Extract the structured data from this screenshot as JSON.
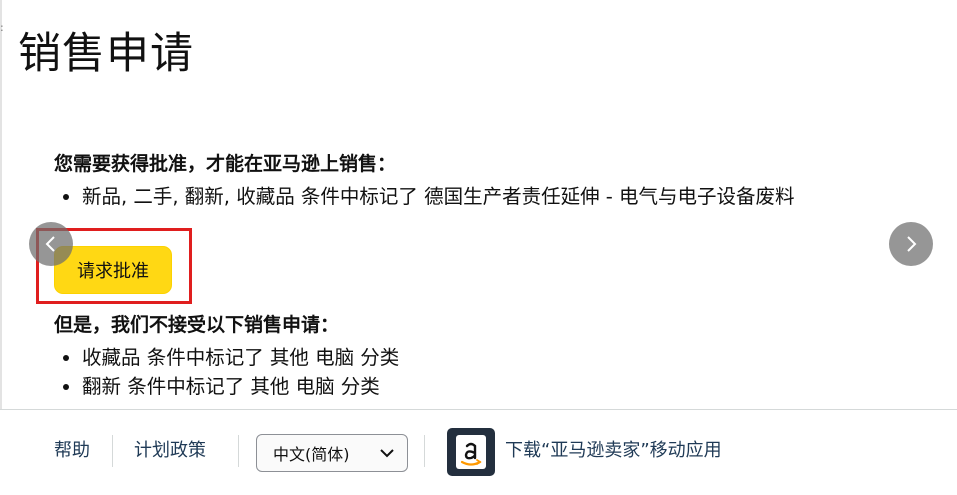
{
  "page": {
    "title": "销售申请"
  },
  "approval": {
    "heading": "您需要获得批准，才能在亚马逊上销售：",
    "items": [
      "新品, 二手, 翻新, 收藏品 条件中标记了 德国生产者责任延伸 - 电气与电子设备废料"
    ],
    "button_label": "请求批准",
    "highlight_color": "#e01e1e",
    "button_color": "#ffd814"
  },
  "rejection": {
    "heading": "但是，我们不接受以下销售申请：",
    "items": [
      "收藏品 条件中标记了 其他 电脑 分类",
      "翻新 条件中标记了 其他 电脑 分类"
    ]
  },
  "carousel": {
    "prev_icon": "chevron-left-icon",
    "next_icon": "chevron-right-icon"
  },
  "footer": {
    "help": "帮助",
    "policy": "计划政策",
    "language": "中文(简体)",
    "app_icon": "amazon-seller-app-icon",
    "app_link": "下载“亚马逊卖家”移动应用"
  }
}
